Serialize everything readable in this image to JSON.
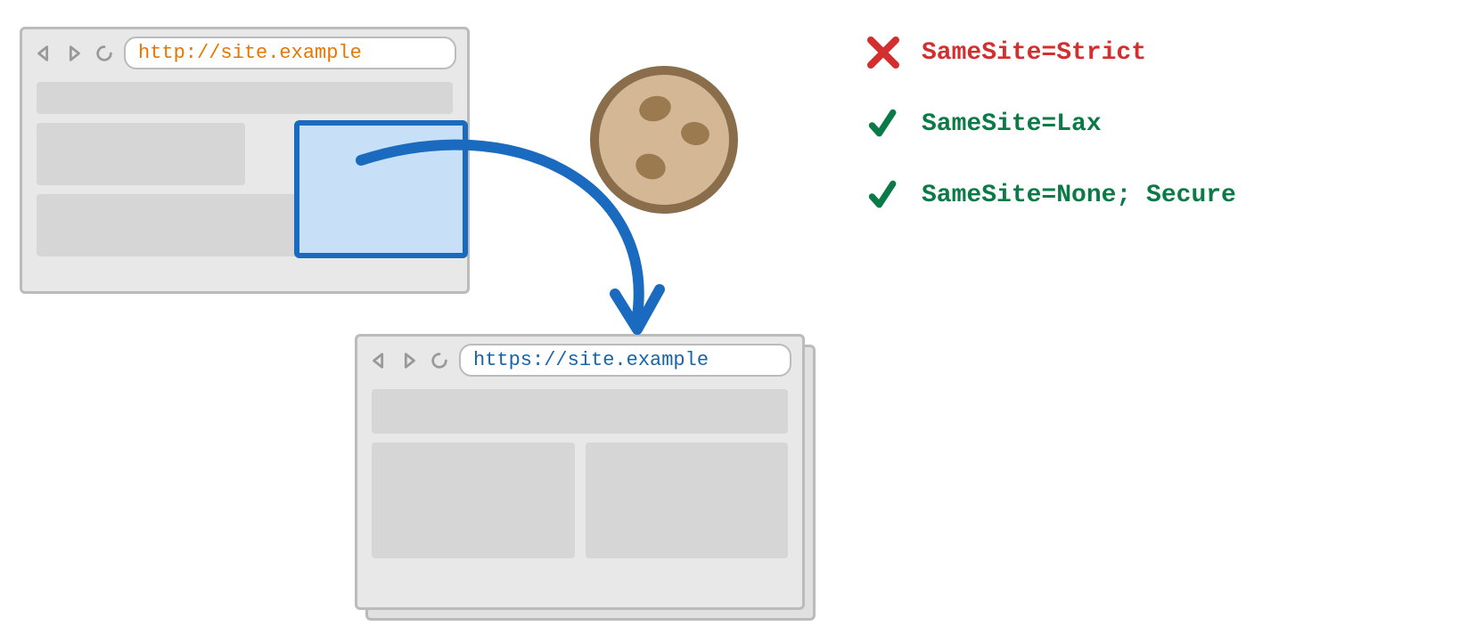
{
  "browser_top": {
    "url": "http://site.example",
    "url_color": "#e67700"
  },
  "browser_bottom": {
    "url": "https://site.example",
    "url_color": "#1864ab"
  },
  "legend": {
    "items": [
      {
        "status": "blocked",
        "label": "SameSite=Strict",
        "color": "#d32f2f"
      },
      {
        "status": "allowed",
        "label": "SameSite=Lax",
        "color": "#0a7a46"
      },
      {
        "status": "allowed",
        "label": "SameSite=None; Secure",
        "color": "#0a7a46"
      }
    ]
  },
  "icons": {
    "back": "back-icon",
    "forward": "forward-icon",
    "reload": "reload-icon",
    "cookie": "cookie-icon",
    "cross": "cross-icon",
    "check": "check-icon"
  }
}
